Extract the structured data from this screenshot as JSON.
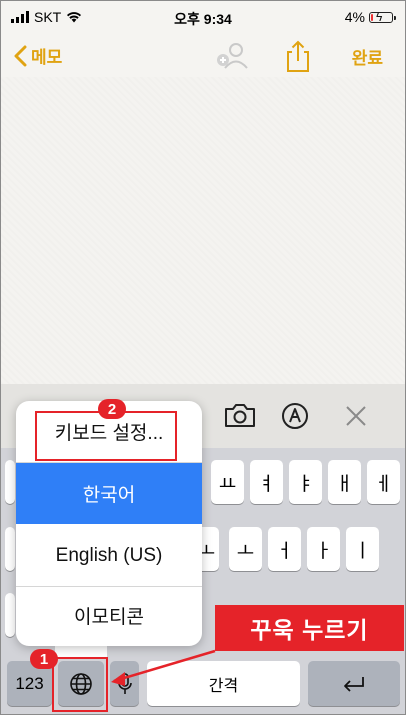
{
  "status_bar": {
    "carrier": "SKT",
    "time": "오후 9:34",
    "battery": "4%",
    "battery_level": 0.04
  },
  "nav": {
    "back_label": "메모",
    "done_label": "완료"
  },
  "toolbar": {
    "icons": [
      "camera-icon",
      "markup-pen-icon",
      "close-icon"
    ]
  },
  "popup": {
    "items": [
      {
        "label": "키보드 설정..."
      },
      {
        "label": "한국어",
        "selected": true
      },
      {
        "label": "English (US)"
      },
      {
        "label": "이모티콘"
      }
    ]
  },
  "keyboard": {
    "row1": [
      "ㅛ",
      "ㅕ",
      "ㅑ",
      "ㅐ",
      "ㅔ"
    ],
    "row2": [
      "ㅗ",
      "ㅓ",
      "ㅏ",
      "ㅣ"
    ],
    "numbers_key": "123",
    "space_label": "간격",
    "return_symbol": "↵"
  },
  "annotations": {
    "badge1": "1",
    "badge2": "2",
    "callout": "꾸욱 누르기",
    "accent_color": "#e52329"
  }
}
